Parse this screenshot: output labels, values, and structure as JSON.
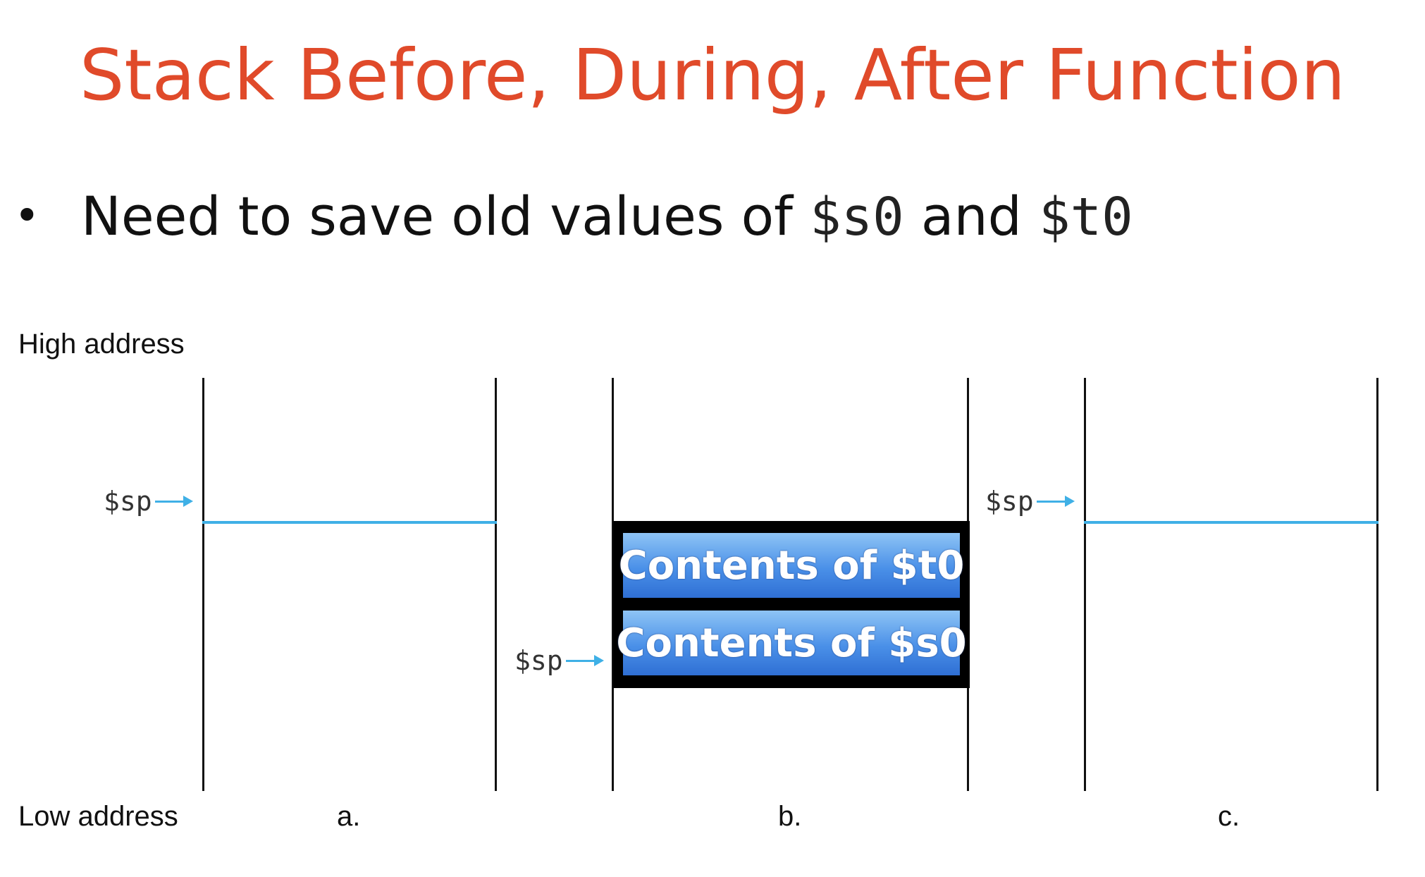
{
  "title": "Stack Before, During, After Function",
  "bullet": {
    "prefix": "Need to save old values of",
    "reg1": "$s0",
    "conj": "and",
    "reg2": "$t0"
  },
  "labels": {
    "high_address": "High address",
    "low_address": "Low address",
    "panel_a": "a.",
    "panel_b": "b.",
    "panel_c": "c."
  },
  "stack_pointer_label": "$sp",
  "panel_b_cells": [
    "Contents of $t0",
    "Contents of $s0"
  ],
  "colors": {
    "title": "#e04a2a",
    "pointer": "#3fb0e6",
    "cell_fill": "#4a90e8"
  }
}
